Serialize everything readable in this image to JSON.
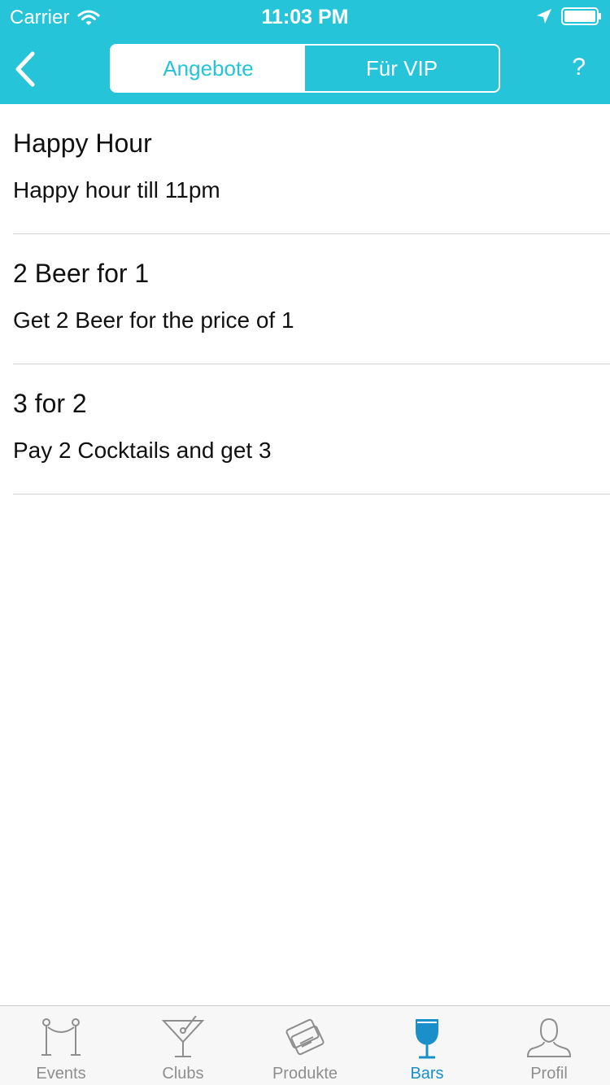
{
  "status_bar": {
    "carrier": "Carrier",
    "time": "11:03 PM"
  },
  "header": {
    "segments": [
      {
        "label": "Angebote",
        "active": true
      },
      {
        "label": "Für VIP",
        "active": false
      }
    ],
    "help_label": "?"
  },
  "offers": [
    {
      "title": "Happy Hour",
      "description": "Happy hour till 11pm"
    },
    {
      "title": "2 Beer for 1",
      "description": "Get 2 Beer for the price of 1"
    },
    {
      "title": "3 for 2",
      "description": "Pay 2 Cocktails and get 3"
    }
  ],
  "tab_bar": {
    "tabs": [
      {
        "label": "Events",
        "icon": "rope-barrier-icon",
        "active": false
      },
      {
        "label": "Clubs",
        "icon": "cocktail-icon",
        "active": false
      },
      {
        "label": "Produkte",
        "icon": "tickets-icon",
        "active": false
      },
      {
        "label": "Bars",
        "icon": "wine-glass-icon",
        "active": true
      },
      {
        "label": "Profil",
        "icon": "person-icon",
        "active": false
      }
    ]
  },
  "colors": {
    "accent": "#26c4d9",
    "tab_active": "#1a8fc9",
    "tab_inactive": "#8e8e8e"
  }
}
